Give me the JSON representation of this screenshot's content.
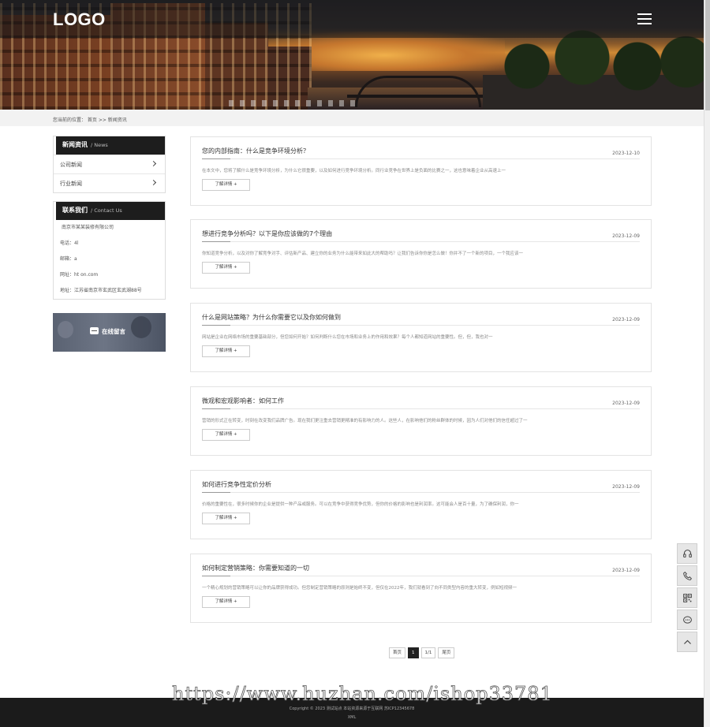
{
  "header": {
    "logo": "LOGO"
  },
  "breadcrumb": "您当前的位置： 首页 >> 新闻资讯",
  "sidebar": {
    "news": {
      "title": "新闻资讯",
      "subtitle": "/ News",
      "items": [
        "公司新闻",
        "行业新闻"
      ]
    },
    "contact": {
      "title": "联系我们",
      "subtitle": "/ Contact Us",
      "lines": [
        "南京市某某装修有限公司",
        "电话：4l",
        "邮箱：a",
        "网址：ht                                on.com",
        "地址：江苏省南京市玄武区玄武湖88号"
      ]
    },
    "message_button": "在线留言"
  },
  "articles": [
    {
      "title": "您的内部指南：什么是竞争环境分析？",
      "date": "2023-12-10",
      "excerpt": "在本文中，您将了解什么是竞争环境分析，为什么它很重要，以及如何进行竞争环境分析。同行业竞争在世界上是负面的比赛之一，这也意味着企业从高速上一",
      "more": "了解详情 +"
    },
    {
      "title": "想进行竞争分析吗？以下是你应该做的7个理由",
      "date": "2023-12-09",
      "excerpt": "你知道竞争分析，以及对你了解竞争对手、评估新产品、建立你的业务为什么能带来如此大的帮助吗？让我们告诉你你是怎么做！你并不了一个新的项目，一个我应该一",
      "more": "了解详情 +"
    },
    {
      "title": "什么是网站策略？为什么你需要它以及你如何做到",
      "date": "2023-12-09",
      "excerpt": "网站是企业在网络市场的重要基础部分，但您如何开始？如何判断什么您在市场和业务上的作用和效果？每个人都知道网站的重要性。但，但，我也对一",
      "more": "了解详情 +"
    },
    {
      "title": "微观和宏观影响者：如何工作",
      "date": "2023-12-09",
      "excerpt": "营销的形式正在转变，时刻在改变我们品牌广告。现在我们更注重去营销更精准的有影响力的人。这些人，在影响他们的粉丝群体的时候，因为人们对他们的信任超过了一",
      "more": "了解详情 +"
    },
    {
      "title": "如何进行竞争性定价分析",
      "date": "2023-12-09",
      "excerpt": "价格的重要性在，很多时候你的企业是提供一种产品或服务。可以在竞争中获得竞争优势，但你的价格的影响也是利润率。这可能会人是百十量，为了确保利润，你一",
      "more": "了解详情 +"
    },
    {
      "title": "如何制定营销策略：你需要知道的一切",
      "date": "2023-12-09",
      "excerpt": "一个精心规划的营销策略可以让你的品牌获得成功。但您制定营销策略的原则是始终不变，但仅在2022年，我们就看到了向不同类型内容的重大转变，例如短视频一",
      "more": "了解详情 +"
    }
  ],
  "pagination": {
    "first": "首页",
    "current": "1",
    "info": "1/1",
    "last": "尾页"
  },
  "float_toolbar": [
    "headset-icon",
    "phone-icon",
    "qrcode-icon",
    "chat-icon",
    "back-to-top-icon"
  ],
  "footer": {
    "copyright": "Copyright © 2023 测试站点 本站资源来源于互联网 苏ICP12345678",
    "xml": "XML"
  },
  "watermark": "https://www.huzhan.com/ishop33781"
}
